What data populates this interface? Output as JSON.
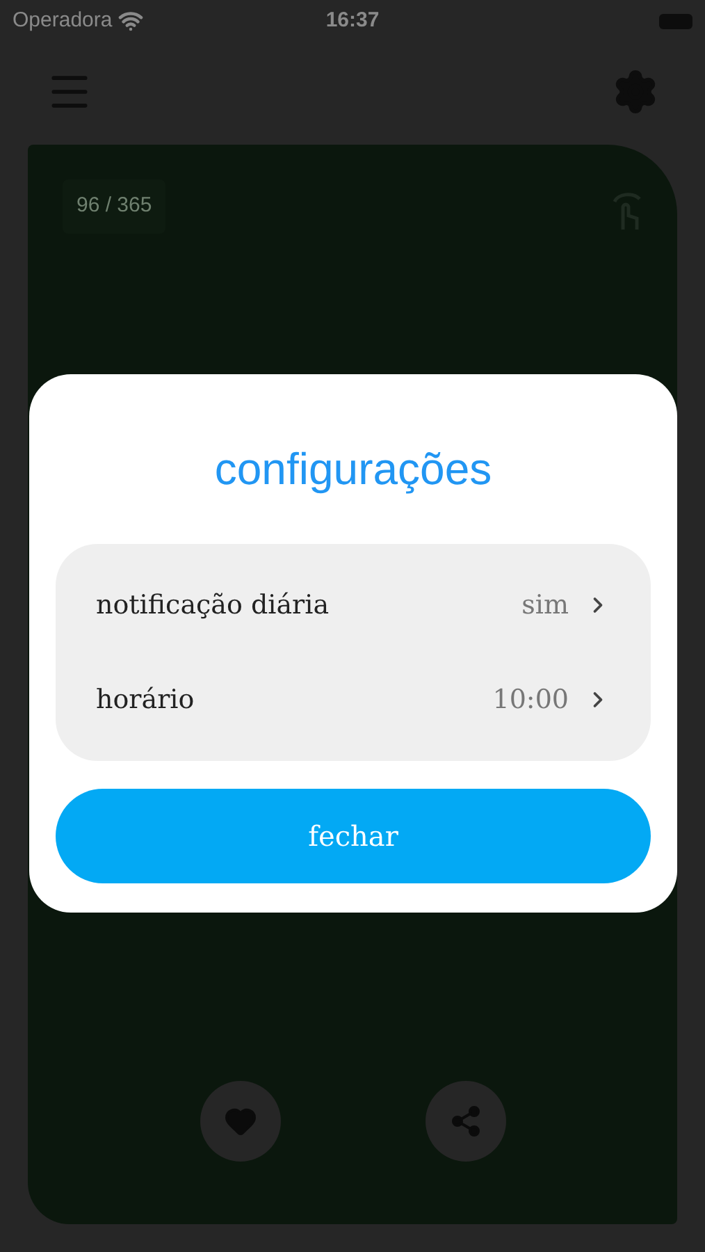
{
  "status_bar": {
    "carrier": "Operadora",
    "time": "16:37"
  },
  "card": {
    "counter": "96 / 365"
  },
  "dialog": {
    "title": "configurações",
    "rows": [
      {
        "label": "notificação diária",
        "value": "sim"
      },
      {
        "label": "horário",
        "value": "10:00"
      }
    ],
    "button": "fechar"
  }
}
